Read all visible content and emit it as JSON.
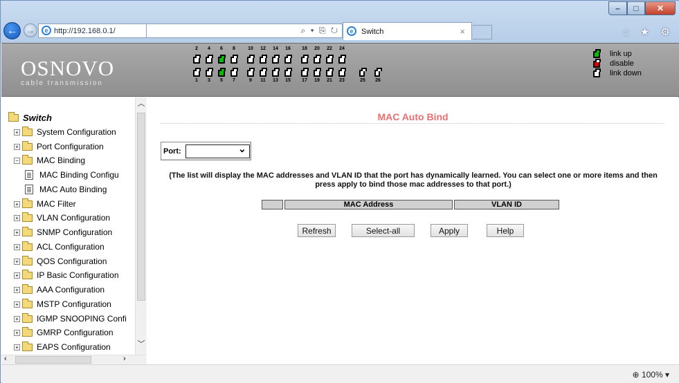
{
  "browser": {
    "url": "http://192.168.0.1/",
    "address_controls": "⌕ ▾ ⎘ ↻",
    "tab_title": "Switch",
    "tab_close": "×",
    "back_glyph": "←",
    "forward_glyph": "→",
    "toolbar_icons": "⌂ ★ ⚙",
    "window_buttons": {
      "minimize": "–",
      "maximize": "□",
      "close": "✕"
    }
  },
  "banner": {
    "logo": "OSNOVO",
    "logo_sub": "cable transmission",
    "top_ports": [
      "2",
      "4",
      "6",
      "8",
      "10",
      "12",
      "14",
      "16",
      "18",
      "20",
      "22",
      "24"
    ],
    "bottom_ports": [
      "1",
      "3",
      "5",
      "7",
      "9",
      "11",
      "13",
      "15",
      "17",
      "19",
      "21",
      "23"
    ],
    "sfp_ports": [
      "25",
      "26"
    ],
    "port_up": [
      "6",
      "5"
    ],
    "legend": {
      "link_up": "link up",
      "disable": "disable",
      "link_down": "link down"
    },
    "colors": {
      "link_up": "#00c000",
      "disable": "#e00000",
      "link_down": "#ffffff"
    }
  },
  "sidebar": {
    "root": "Switch",
    "items": [
      {
        "label": "System Configuration"
      },
      {
        "label": "Port Configuration"
      },
      {
        "label": "MAC Binding"
      },
      {
        "label": "MAC Binding Configu"
      },
      {
        "label": "MAC Auto Binding"
      },
      {
        "label": "MAC Filter"
      },
      {
        "label": "VLAN Configuration"
      },
      {
        "label": "SNMP Configuration"
      },
      {
        "label": "ACL Configuration"
      },
      {
        "label": "QOS Configuration"
      },
      {
        "label": "IP Basic Configuration"
      },
      {
        "label": "AAA Configuration"
      },
      {
        "label": "MSTP Configuration"
      },
      {
        "label": "IGMP SNOOPING Confi"
      },
      {
        "label": "GMRP Configuration"
      },
      {
        "label": "EAPS Configuration"
      }
    ]
  },
  "main": {
    "title": "MAC Auto Bind",
    "port_label": "Port:",
    "port_value": "",
    "description": "(The list will display the MAC addresses and VLAN ID that the port has dynamically learned. You can select one or more items and then press apply to bind those mac addresses to that port.)",
    "columns": [
      "",
      "MAC Address",
      "VLAN ID"
    ],
    "buttons": {
      "refresh": "Refresh",
      "select_all": "Select-all",
      "apply": "Apply",
      "help": "Help"
    },
    "title_color": "#e86f6f"
  },
  "status": {
    "zoom": "100%"
  }
}
